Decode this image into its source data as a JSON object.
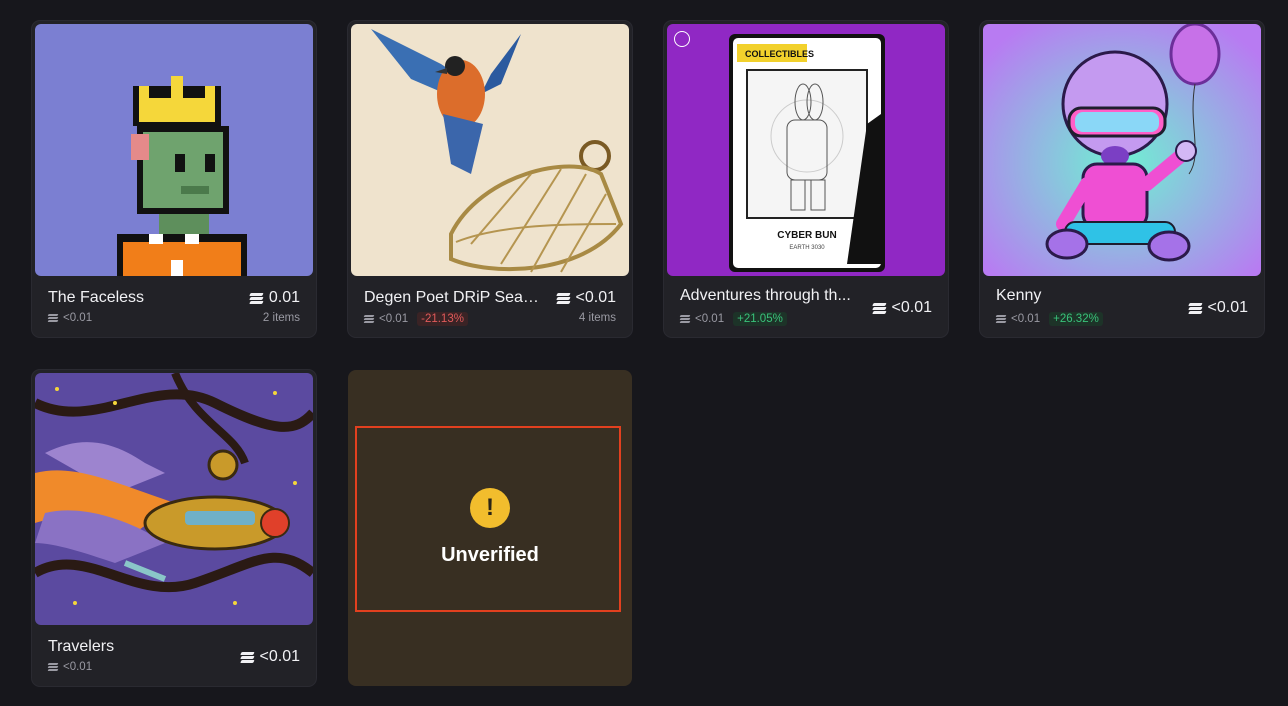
{
  "collections": [
    {
      "name": "The Faceless",
      "price": "0.01",
      "floor": "<0.01",
      "change": "",
      "items": "2 items"
    },
    {
      "name": "Degen Poet DRiP Seas...",
      "price": "<0.01",
      "floor": "<0.01",
      "change": "-21.13%",
      "items": "4 items"
    },
    {
      "name": "Adventures through th...",
      "price": "<0.01",
      "floor": "<0.01",
      "change": "+21.05%",
      "items": ""
    },
    {
      "name": "Kenny",
      "price": "<0.01",
      "floor": "<0.01",
      "change": "+26.32%",
      "items": ""
    },
    {
      "name": "Travelers",
      "price": "<0.01",
      "floor": "<0.01",
      "change": "",
      "items": ""
    }
  ],
  "unverified": {
    "label": "Unverified",
    "icon": "exclamation-icon",
    "icon_color": "#f2bd2d"
  },
  "artwork": {
    "card3_header": "COLLECTIBLES",
    "card3_title": "CYBER BUN",
    "card3_subtitle": "EARTH 3030"
  },
  "colors": {
    "background": "#17171c",
    "card": "#222227",
    "negative": "#e05a5a",
    "positive": "#39c27a",
    "unverified_border": "#e2401f"
  }
}
